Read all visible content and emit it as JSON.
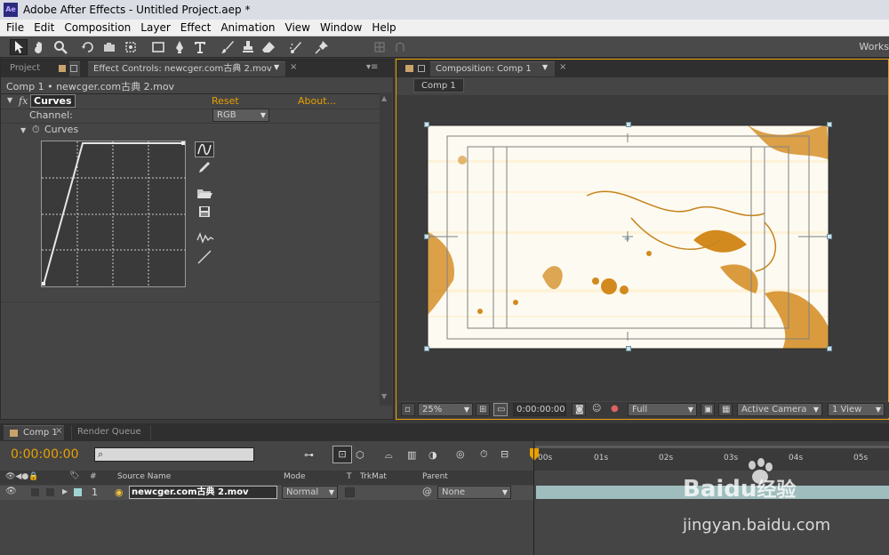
{
  "window": {
    "title": "Adobe After Effects - Untitled Project.aep *",
    "app_icon": "Ae"
  },
  "menu": [
    "File",
    "Edit",
    "Composition",
    "Layer",
    "Effect",
    "Animation",
    "View",
    "Window",
    "Help"
  ],
  "toolbar": {
    "workspace_label": "Works",
    "tools": [
      "selection-tool",
      "hand-tool",
      "zoom-tool",
      "rotation-tool",
      "camera-tool",
      "pan-behind-tool",
      "rectangle-tool",
      "pen-tool",
      "type-tool",
      "brush-tool",
      "clone-stamp-tool",
      "eraser-tool",
      "roto-brush-tool",
      "puppet-pin-tool"
    ]
  },
  "left_panel": {
    "tabs": [
      "Project",
      "Effect Controls: newcger.com古典 2.mov"
    ],
    "breadcrumb": "Comp 1 • newcger.com古典 2.mov",
    "effect_name": "Curves",
    "fx_badge": "fx",
    "reset": "Reset",
    "about": "About...",
    "channel_label": "Channel:",
    "channel_value": "RGB",
    "curves_label": "Curves"
  },
  "comp_panel": {
    "tab": "Composition: Comp 1",
    "comp_button": "Comp 1",
    "zoom": "25%",
    "timecode": "0:00:00:00",
    "resolution": "Full",
    "camera": "Active Camera",
    "views": "1 View"
  },
  "timeline": {
    "tabs": [
      "Comp 1",
      "Render Queue"
    ],
    "timecode": "0:00:00:00",
    "search_placeholder": "",
    "columns": {
      "hash": "#",
      "source": "Source Name",
      "mode": "Mode",
      "t": "T",
      "trkmat": "TrkMat",
      "parent": "Parent"
    },
    "ruler": [
      "00s",
      "01s",
      "02s",
      "03s",
      "04s",
      "05s"
    ],
    "layers": [
      {
        "number": "1",
        "name": "newcger.com古典 2.mov",
        "mode": "Normal",
        "parent": "None"
      }
    ]
  },
  "watermark": {
    "brand": "Baidu",
    "brand_cn": "经验",
    "url": "jingyan.baidu.com"
  },
  "colors": {
    "accent": "#e8a000",
    "panel": "#454545",
    "timeline_bar": "#9fbdbd",
    "playhead": "#e02020"
  }
}
